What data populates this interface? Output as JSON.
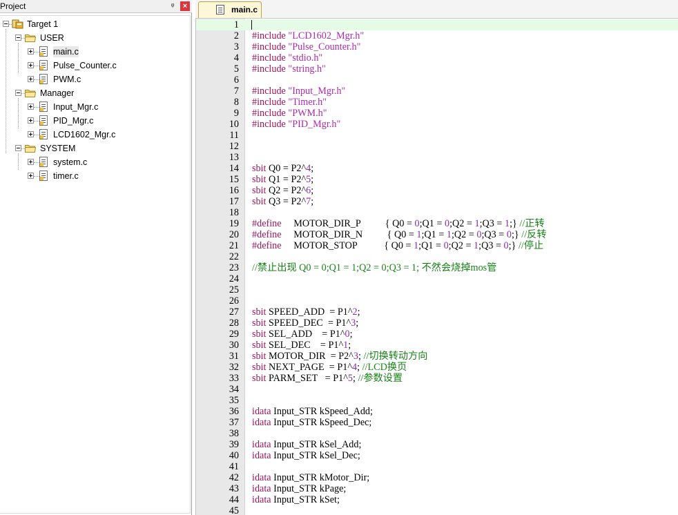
{
  "project_pane": {
    "title": "Project",
    "pin_glyph": "ᵠ",
    "close_glyph": "×",
    "tree": [
      {
        "label": "Target 1",
        "level": 0,
        "kind": "target"
      },
      {
        "label": "USER",
        "level": 1,
        "kind": "folder"
      },
      {
        "label": "main.c",
        "level": 2,
        "kind": "file",
        "selected": true
      },
      {
        "label": "Pulse_Counter.c",
        "level": 2,
        "kind": "file"
      },
      {
        "label": "PWM.c",
        "level": 2,
        "kind": "file"
      },
      {
        "label": "Manager",
        "level": 1,
        "kind": "folder"
      },
      {
        "label": "Input_Mgr.c",
        "level": 2,
        "kind": "file"
      },
      {
        "label": "PID_Mgr.c",
        "level": 2,
        "kind": "file"
      },
      {
        "label": "LCD1602_Mgr.c",
        "level": 2,
        "kind": "file"
      },
      {
        "label": "SYSTEM",
        "level": 1,
        "kind": "folder"
      },
      {
        "label": "system.c",
        "level": 2,
        "kind": "file"
      },
      {
        "label": "timer.c",
        "level": 2,
        "kind": "file"
      }
    ]
  },
  "editor": {
    "active_tab": "main.c",
    "current_line": 1,
    "lines": [
      [],
      [
        [
          "pp",
          "#include "
        ],
        [
          "str",
          "\"LCD1602_Mgr.h\""
        ]
      ],
      [
        [
          "pp",
          "#include "
        ],
        [
          "str",
          "\"Pulse_Counter.h\""
        ]
      ],
      [
        [
          "pp",
          "#include "
        ],
        [
          "str",
          "\"stdio.h\""
        ]
      ],
      [
        [
          "pp",
          "#include "
        ],
        [
          "str",
          "\"string.h\""
        ]
      ],
      [],
      [
        [
          "pp",
          "#include "
        ],
        [
          "str",
          "\"Input_Mgr.h\""
        ]
      ],
      [
        [
          "pp",
          "#include "
        ],
        [
          "str",
          "\"Timer.h\""
        ]
      ],
      [
        [
          "pp",
          "#include "
        ],
        [
          "str",
          "\"PWM.h\""
        ]
      ],
      [
        [
          "pp",
          "#include "
        ],
        [
          "str",
          "\"PID_Mgr.h\""
        ]
      ],
      [],
      [],
      [],
      [
        [
          "kw",
          "sbit"
        ],
        [
          "plain",
          " Q0 = P2^"
        ],
        [
          "num",
          "4"
        ],
        [
          "plain",
          ";"
        ]
      ],
      [
        [
          "kw",
          "sbit"
        ],
        [
          "plain",
          " Q1 = P2^"
        ],
        [
          "num",
          "5"
        ],
        [
          "plain",
          ";"
        ]
      ],
      [
        [
          "kw",
          "sbit"
        ],
        [
          "plain",
          " Q2 = P2^"
        ],
        [
          "num",
          "6"
        ],
        [
          "plain",
          ";"
        ]
      ],
      [
        [
          "kw",
          "sbit"
        ],
        [
          "plain",
          " Q3 = P2^"
        ],
        [
          "num",
          "7"
        ],
        [
          "plain",
          ";"
        ]
      ],
      [],
      [
        [
          "pp",
          "#define     "
        ],
        [
          "plain",
          "MOTOR_DIR_P          { Q0 = "
        ],
        [
          "num",
          "0"
        ],
        [
          "plain",
          ";Q1 = "
        ],
        [
          "num",
          "0"
        ],
        [
          "plain",
          ";Q2 = "
        ],
        [
          "num",
          "1"
        ],
        [
          "plain",
          ";Q3 = "
        ],
        [
          "num",
          "1"
        ],
        [
          "plain",
          ";} "
        ],
        [
          "cmt",
          "//正转"
        ]
      ],
      [
        [
          "pp",
          "#define     "
        ],
        [
          "plain",
          "MOTOR_DIR_N          { Q0 = "
        ],
        [
          "num",
          "1"
        ],
        [
          "plain",
          ";Q1 = "
        ],
        [
          "num",
          "1"
        ],
        [
          "plain",
          ";Q2 = "
        ],
        [
          "num",
          "0"
        ],
        [
          "plain",
          ";Q3 = "
        ],
        [
          "num",
          "0"
        ],
        [
          "plain",
          ";} "
        ],
        [
          "cmt",
          "//反转"
        ]
      ],
      [
        [
          "pp",
          "#define     "
        ],
        [
          "plain",
          "MOTOR_STOP           { Q0 = "
        ],
        [
          "num",
          "1"
        ],
        [
          "plain",
          ";Q1 = "
        ],
        [
          "num",
          "0"
        ],
        [
          "plain",
          ";Q2 = "
        ],
        [
          "num",
          "1"
        ],
        [
          "plain",
          ";Q3 = "
        ],
        [
          "num",
          "0"
        ],
        [
          "plain",
          ";} "
        ],
        [
          "cmt",
          "//停止"
        ]
      ],
      [],
      [
        [
          "cmt",
          "//禁止出现 Q0 = 0;Q1 = 1;Q2 = 0;Q3 = 1; 不然会烧掉mos管"
        ]
      ],
      [],
      [],
      [],
      [
        [
          "kw",
          "sbit"
        ],
        [
          "plain",
          " SPEED_ADD  = P1^"
        ],
        [
          "num",
          "2"
        ],
        [
          "plain",
          ";"
        ]
      ],
      [
        [
          "kw",
          "sbit"
        ],
        [
          "plain",
          " SPEED_DEC  = P1^"
        ],
        [
          "num",
          "3"
        ],
        [
          "plain",
          ";"
        ]
      ],
      [
        [
          "kw",
          "sbit"
        ],
        [
          "plain",
          " SEL_ADD    = P1^"
        ],
        [
          "num",
          "0"
        ],
        [
          "plain",
          ";"
        ]
      ],
      [
        [
          "kw",
          "sbit"
        ],
        [
          "plain",
          " SEL_DEC    = P1^"
        ],
        [
          "num",
          "1"
        ],
        [
          "plain",
          ";"
        ]
      ],
      [
        [
          "kw",
          "sbit"
        ],
        [
          "plain",
          " MOTOR_DIR  = P2^"
        ],
        [
          "num",
          "3"
        ],
        [
          "plain",
          "; "
        ],
        [
          "cmt",
          "//切换转动方向"
        ]
      ],
      [
        [
          "kw",
          "sbit"
        ],
        [
          "plain",
          " NEXT_PAGE  = P1^"
        ],
        [
          "num",
          "4"
        ],
        [
          "plain",
          "; "
        ],
        [
          "cmt",
          "//LCD换页"
        ]
      ],
      [
        [
          "kw",
          "sbit"
        ],
        [
          "plain",
          " PARM_SET   = P1^"
        ],
        [
          "num",
          "5"
        ],
        [
          "plain",
          "; "
        ],
        [
          "cmt",
          "//参数设置"
        ]
      ],
      [],
      [],
      [
        [
          "kw",
          "idata"
        ],
        [
          "plain",
          " Input_STR kSpeed_Add;"
        ]
      ],
      [
        [
          "kw",
          "idata"
        ],
        [
          "plain",
          " Input_STR kSpeed_Dec;"
        ]
      ],
      [],
      [
        [
          "kw",
          "idata"
        ],
        [
          "plain",
          " Input_STR kSel_Add;"
        ]
      ],
      [
        [
          "kw",
          "idata"
        ],
        [
          "plain",
          " Input_STR kSel_Dec;"
        ]
      ],
      [],
      [
        [
          "kw",
          "idata"
        ],
        [
          "plain",
          " Input_STR kMotor_Dir;"
        ]
      ],
      [
        [
          "kw",
          "idata"
        ],
        [
          "plain",
          " Input_STR kPage;"
        ]
      ],
      [
        [
          "kw",
          "idata"
        ],
        [
          "plain",
          " Input_STR kSet;"
        ]
      ],
      []
    ]
  }
}
